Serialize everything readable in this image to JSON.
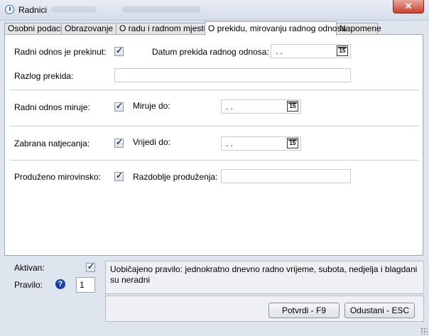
{
  "window": {
    "title": "Radnici",
    "close_glyph": "✕"
  },
  "tabs": [
    {
      "label": "Osobni podaci",
      "active": false
    },
    {
      "label": "Obrazovanje",
      "active": false
    },
    {
      "label": "O radu i radnom mjestu",
      "active": false
    },
    {
      "label": "O prekidu, mirovanju radnog odnosa",
      "active": true
    },
    {
      "label": "Napomene",
      "active": false
    }
  ],
  "form": {
    "interrupted_label": "Radni odnos je prekinut:",
    "interrupted_checked": true,
    "interrupt_date_label": "Datum prekida radnog odnosa:",
    "interrupt_date_value": ". .",
    "reason_label": "Razlog prekida:",
    "reason_value": "",
    "dormant_label": "Radni odnos miruje:",
    "dormant_checked": true,
    "dormant_until_label": "Miruje do:",
    "dormant_until_value": ". .",
    "noncompete_label": "Zabrana natjecanja:",
    "noncompete_checked": true,
    "valid_until_label": "Vrijedi do:",
    "valid_until_value": ". .",
    "extended_pension_label": "Produženo mirovinsko:",
    "extended_pension_checked": true,
    "extension_period_label": "Razdoblje produženja:",
    "extension_period_value": "",
    "calendar_icon": "calendar-icon",
    "calendar_glyph": "15"
  },
  "footer": {
    "active_label": "Aktivan:",
    "active_checked": true,
    "rule_label": "Pravilo:",
    "rule_value": "1",
    "help_glyph": "?",
    "rule_text": "Uobičajeno pravilo: jednokratno dnevno radno vrijeme, subota, nedjelja i blagdani su neradni",
    "confirm_label": "Potvrdi - F9",
    "cancel_label": "Odustani - ESC"
  }
}
